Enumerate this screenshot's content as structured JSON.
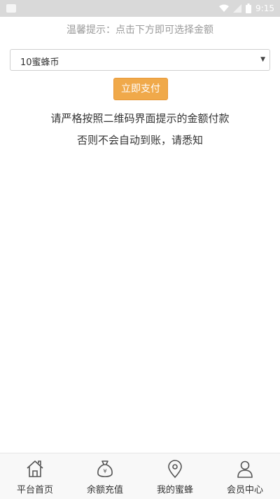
{
  "status_bar": {
    "time": "9:15"
  },
  "hint": "温馨提示：点击下方即可选择金额",
  "select": {
    "value": "10蜜蜂币"
  },
  "pay_button": "立即支付",
  "notice": {
    "line1": "请严格按照二维码界面提示的金额付款",
    "line2": "否则不会自动到账，请悉知"
  },
  "bottom_nav": [
    {
      "label": "平台首页",
      "icon": "home-icon"
    },
    {
      "label": "余额充值",
      "icon": "money-bag-icon"
    },
    {
      "label": "我的蜜蜂",
      "icon": "location-pin-icon"
    },
    {
      "label": "会员中心",
      "icon": "user-icon"
    }
  ]
}
